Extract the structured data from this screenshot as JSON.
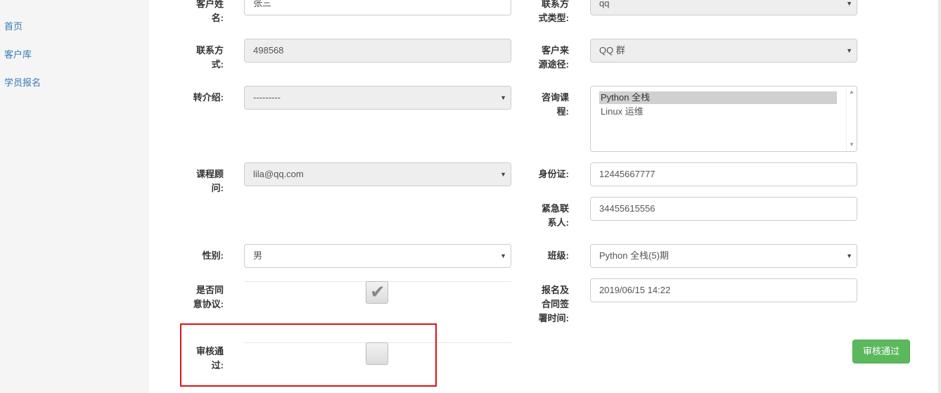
{
  "sidebar": {
    "items": [
      "首页",
      "客户库",
      "学员报名"
    ]
  },
  "form": {
    "name": {
      "label_l1": "客户姓",
      "label_l2": "名:",
      "value": "张三"
    },
    "contact_type": {
      "label_l1": "联系方",
      "label_l2": "式类型:",
      "value": "qq"
    },
    "contact": {
      "label_l1": "联系方",
      "label_l2": "式:",
      "value": "498568"
    },
    "source": {
      "label_l1": "客户来",
      "label_l2": "源途径:",
      "value": "QQ 群"
    },
    "referral": {
      "label": "转介绍:",
      "value": "---------"
    },
    "course": {
      "label_l1": "咨询课",
      "label_l2": "程:",
      "options": [
        "Python 全栈",
        "Linux 运维"
      ],
      "selected": "Python 全栈"
    },
    "consultant": {
      "label_l1": "课程顾",
      "label_l2": "问:",
      "value": "lila@qq.com"
    },
    "id_card": {
      "label": "身份证:",
      "value": "12445667777"
    },
    "emergency": {
      "label_l1": "紧急联",
      "label_l2": "系人:",
      "value": "34455615556"
    },
    "gender": {
      "label": "性别:",
      "value": "男"
    },
    "class": {
      "label": "班级:",
      "value": "Python 全栈(5)期"
    },
    "agree": {
      "label_l1": "是否同",
      "label_l2": "意协议:",
      "checked": true
    },
    "sign_time": {
      "label_l1": "报名及",
      "label_l2": "合同签",
      "label_l3": "署时间:",
      "value": "2019/06/15 14:22"
    },
    "approved": {
      "label_l1": "审核通",
      "label_l2": "过:",
      "checked": false
    }
  },
  "actions": {
    "approve_label": "审核通过"
  },
  "colors": {
    "link": "#337ab7",
    "approve_button": "#5cb85c",
    "highlight": "#dd1111"
  }
}
